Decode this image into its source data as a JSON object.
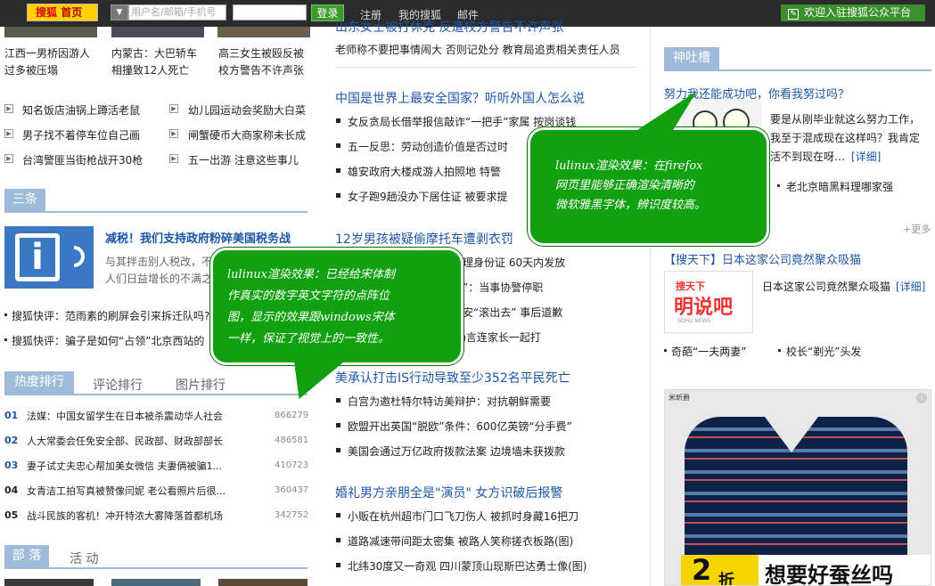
{
  "topbar": {
    "logo_a": "搜狐",
    "logo_b": "首页",
    "username_placeholder": "用户名/邮箱/手机号",
    "login": "登录",
    "links": [
      "注册",
      "我的搜狐",
      "邮件"
    ],
    "welcome": "欢迎入驻搜狐公众平台"
  },
  "left": {
    "photo_captions": [
      [
        "江西一男桥因游人",
        "过多被压塌"
      ],
      [
        "内蒙古：大巴轿车",
        "相撞致12人死亡"
      ],
      [
        "高三女生被殴反被",
        "校方警告不许声张"
      ]
    ],
    "news": [
      [
        "知名饭店油锅上蹲活老鼠",
        "幼儿园运动会奖励大白菜"
      ],
      [
        "男子找不着停车位自己画",
        "闸蟹硬币大商家称未长成"
      ],
      [
        "台湾警匪当街枪战开30枪",
        "五一出游  注意这些事儿"
      ]
    ],
    "sangtiao": {
      "tab": "三条",
      "headline": "减税！我们支持政府粉碎美国税务战",
      "summary": [
        "与其拌击别人税改，不",
        "人们日益增长的不满之"
      ],
      "items": [
        "搜狐快评：范雨素的刷屏会引来拆迁队吗?",
        "搜狐快评：骗子是如何“占领”北京西站的"
      ]
    },
    "rank_tabs": [
      "热度排行",
      "评论排行",
      "图片排行"
    ],
    "rank": [
      {
        "n": "01",
        "t": "法媒：中国女留学生在日本被杀震动华人社会",
        "c": "866279"
      },
      {
        "n": "02",
        "t": "人大常委会任免安全部、民政部、财政部部长",
        "c": "486581"
      },
      {
        "n": "03",
        "t": "妻子试丈夫忠心帮加美女微信 夫妻俩被骗1...",
        "c": "410723"
      },
      {
        "n": "04",
        "t": "女青洁工拍写真被赞像闫妮 老公看照片后很...",
        "c": "360437"
      },
      {
        "n": "05",
        "t": "战斗民族的客机！冲开特浓大雾降落首都机场",
        "c": "342752"
      }
    ],
    "bulo_tabs": [
      "部 落",
      "活 动"
    ]
  },
  "mid": {
    "top_head": "山东女士被打休克 反遭校方警告不许声张",
    "top_sub": "老师称不要把事情闹大  否则记处分  教育局追责相关责任人员",
    "sections": [
      {
        "head": "中国是世界上最安全国家？听听外国人怎么说",
        "items": [
          "女反贪局长借举报信敲诈“一把手”家属  按岗谈钱",
          "五一反思：劳动创造价值是否过时",
          "雄安政府大楼成游人拍照地  特警",
          "女子跑9趟没办下居住证  被要求提"
        ]
      },
      {
        "head": "12岁男孩被疑偷摩托车遭剥衣罚",
        "items": [
          "异地办理身份证  60天内发放",
          "机对骂”：当事协警停职",
          "旗让保安“滚出去”  事后道歉",
          "学生  扬言连家长一起打"
        ]
      },
      {
        "head": "美承认打击IS行动导致至少352名平民死亡",
        "items": [
          "白宫为邀杜特尔特访美辩护：对抗朝鲜需要",
          "欧盟开出英国“脱欧”条件：600亿英镑“分手费”",
          "美国会通过万亿政府拨款法案  边境墙未获拨款"
        ]
      },
      {
        "head": "婚礼男方亲朋全是\"演员\" 女方识破后报警",
        "items": [
          "小贩在杭州超市门口飞刀伤人  被抓时身藏16把刀",
          "道路减速带间距太密集  被路人笑称搓衣板路(图)",
          "北纬30度又一奇观  四川蒙顶山现斯巴达勇士像(图)"
        ]
      }
    ]
  },
  "right": {
    "tab": "神吐槽",
    "head": "努力我还能成功吧，你看我努过吗？",
    "summary": [
      "要是从刚毕业就这么努力工作，",
      "我至于混成现在这样吗？我肯定",
      "活不到现在呀…"
    ],
    "detail": "[详细]",
    "line": "老北京暗黑料理哪家强",
    "more": "更多",
    "sky_head": "【搜天下】日本这家公司竟然聚众吸猫",
    "sky_text": "日本这家公司竟然聚众吸猫",
    "sky_detail": "[详细]",
    "sky_img": [
      "搜天下",
      "明说吧",
      "SOHU NEWS"
    ],
    "links": [
      "奇葩“一夫两妻”",
      "校长“剃光”头发"
    ],
    "ad": {
      "brand": "米昕爵",
      "price_a": "2",
      "price_b": "折",
      "slogan": "想要好蚕丝吗"
    }
  },
  "bubbles": {
    "firefox": [
      "lulinux渲染效果：在firefox",
      "网页里能够正确渲染清晰的",
      "微软雅黑字体，辨识度较高。"
    ],
    "song": [
      "lulinux渲染效果：已经给宋体制",
      "作真实的数字英文字符的点阵位",
      "图，显示的效果跟windows宋体",
      "一样，保证了视觉上的一致性。"
    ]
  },
  "colors": {
    "accent": "#1c56a6",
    "tab": "#9ebbd9",
    "bubble": "#11a010",
    "topbar": "#2b2b2b"
  }
}
